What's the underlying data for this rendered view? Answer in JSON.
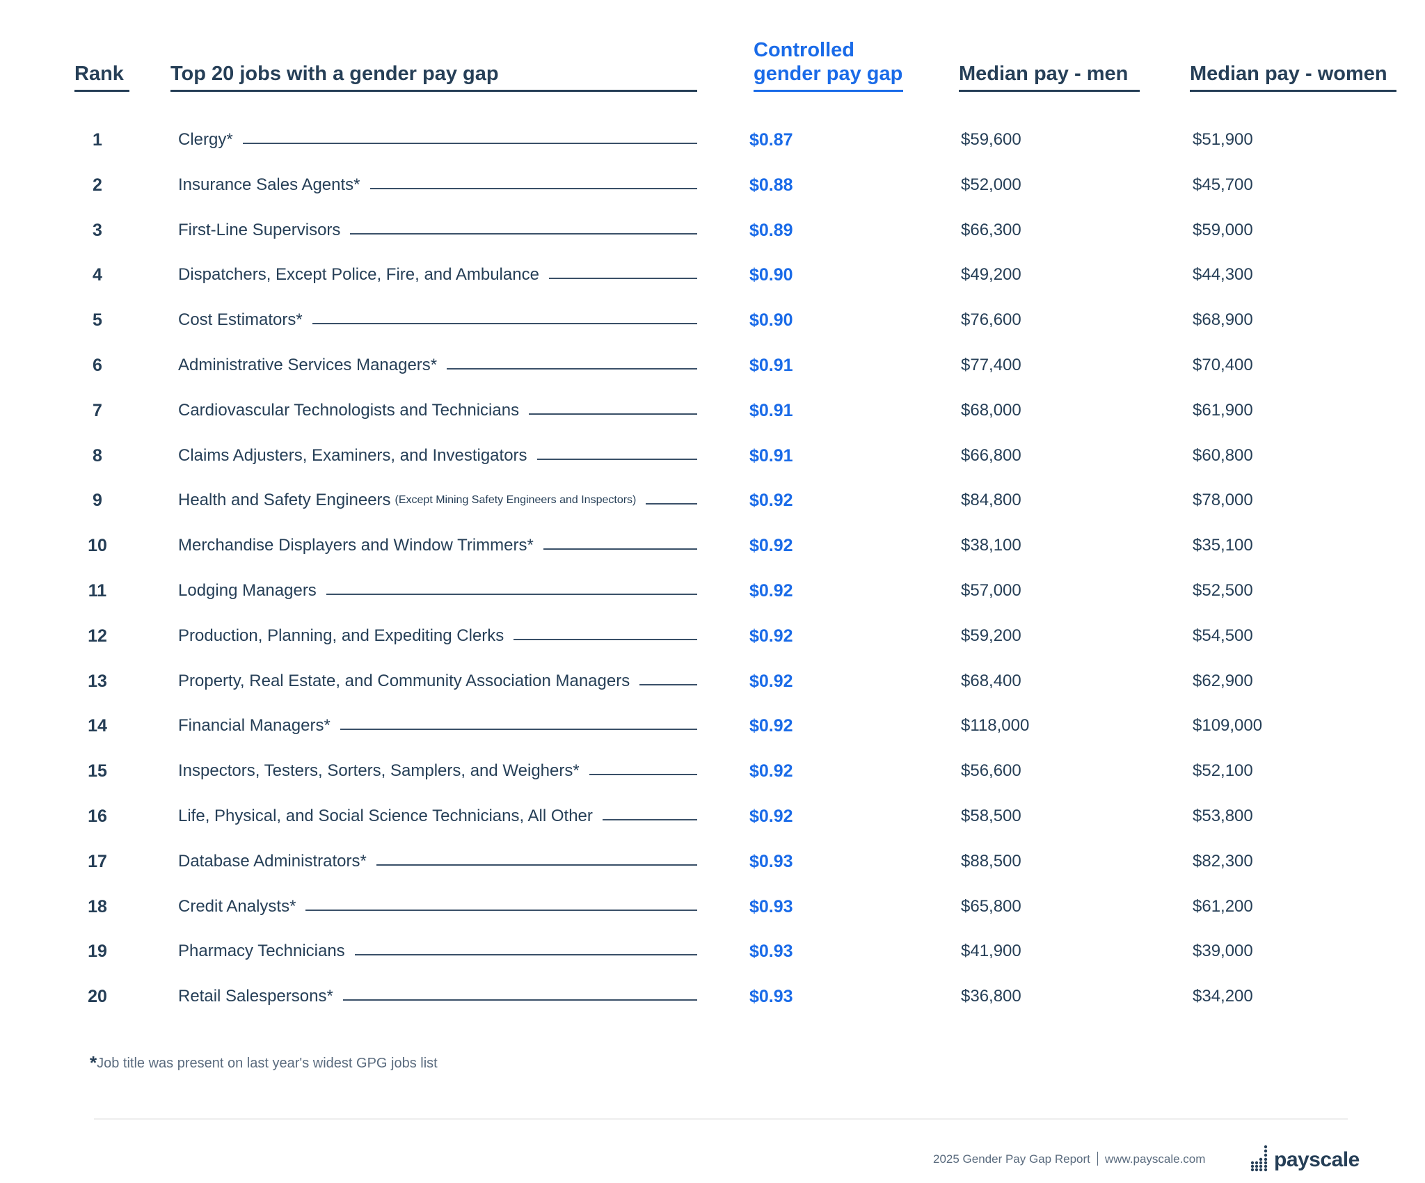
{
  "header": {
    "rank": "Rank",
    "job": "Top 20 jobs with a gender pay gap",
    "gap_line1": "Controlled",
    "gap_line2": "gender pay gap",
    "men": "Median pay - men",
    "women": "Median pay - women"
  },
  "colors": {
    "text": "#263f57",
    "accent": "#1a6be8",
    "muted": "#5a6b7e"
  },
  "rows": [
    {
      "rank": "1",
      "job": "Clergy*",
      "sub": "",
      "gap": "$0.87",
      "men": "$59,600",
      "women": "$51,900"
    },
    {
      "rank": "2",
      "job": "Insurance Sales Agents*",
      "sub": "",
      "gap": "$0.88",
      "men": "$52,000",
      "women": "$45,700"
    },
    {
      "rank": "3",
      "job": "First-Line Supervisors",
      "sub": "",
      "gap": "$0.89",
      "men": "$66,300",
      "women": "$59,000"
    },
    {
      "rank": "4",
      "job": "Dispatchers, Except Police, Fire, and Ambulance",
      "sub": "",
      "gap": "$0.90",
      "men": "$49,200",
      "women": "$44,300"
    },
    {
      "rank": "5",
      "job": "Cost Estimators*",
      "sub": "",
      "gap": "$0.90",
      "men": "$76,600",
      "women": "$68,900"
    },
    {
      "rank": "6",
      "job": "Administrative Services Managers*",
      "sub": "",
      "gap": "$0.91",
      "men": "$77,400",
      "women": "$70,400"
    },
    {
      "rank": "7",
      "job": "Cardiovascular Technologists and Technicians",
      "sub": "",
      "gap": "$0.91",
      "men": "$68,000",
      "women": "$61,900"
    },
    {
      "rank": "8",
      "job": "Claims Adjusters, Examiners, and Investigators",
      "sub": "",
      "gap": "$0.91",
      "men": "$66,800",
      "women": "$60,800"
    },
    {
      "rank": "9",
      "job": "Health and Safety Engineers",
      "sub": "(Except Mining Safety Engineers and Inspectors)",
      "gap": "$0.92",
      "men": "$84,800",
      "women": "$78,000"
    },
    {
      "rank": "10",
      "job": "Merchandise Displayers and Window Trimmers*",
      "sub": "",
      "gap": "$0.92",
      "men": "$38,100",
      "women": "$35,100"
    },
    {
      "rank": "11",
      "job": "Lodging Managers",
      "sub": "",
      "gap": "$0.92",
      "men": "$57,000",
      "women": "$52,500"
    },
    {
      "rank": "12",
      "job": "Production, Planning, and Expediting Clerks",
      "sub": "",
      "gap": "$0.92",
      "men": "$59,200",
      "women": "$54,500"
    },
    {
      "rank": "13",
      "job": "Property, Real Estate, and Community Association Managers",
      "sub": "",
      "gap": "$0.92",
      "men": "$68,400",
      "women": "$62,900"
    },
    {
      "rank": "14",
      "job": "Financial Managers*",
      "sub": "",
      "gap": "$0.92",
      "men": "$118,000",
      "women": "$109,000"
    },
    {
      "rank": "15",
      "job": "Inspectors, Testers, Sorters, Samplers, and Weighers*",
      "sub": "",
      "gap": "$0.92",
      "men": "$56,600",
      "women": "$52,100"
    },
    {
      "rank": "16",
      "job": "Life, Physical, and Social Science Technicians, All Other",
      "sub": "",
      "gap": "$0.92",
      "men": "$58,500",
      "women": "$53,800"
    },
    {
      "rank": "17",
      "job": "Database Administrators*",
      "sub": "",
      "gap": "$0.93",
      "men": "$88,500",
      "women": "$82,300"
    },
    {
      "rank": "18",
      "job": "Credit Analysts*",
      "sub": "",
      "gap": "$0.93",
      "men": "$65,800",
      "women": "$61,200"
    },
    {
      "rank": "19",
      "job": "Pharmacy Technicians",
      "sub": "",
      "gap": "$0.93",
      "men": "$41,900",
      "women": "$39,000"
    },
    {
      "rank": "20",
      "job": "Retail Salespersons*",
      "sub": "",
      "gap": "$0.93",
      "men": "$36,800",
      "women": "$34,200"
    }
  ],
  "footnote": {
    "star": "*",
    "text": "Job title was present on last year's widest GPG jobs list"
  },
  "footer": {
    "report": "2025 Gender Pay Gap Report",
    "url": "www.payscale.com",
    "logo_icon": "payscale-dots-icon",
    "logo_text": "payscale"
  }
}
